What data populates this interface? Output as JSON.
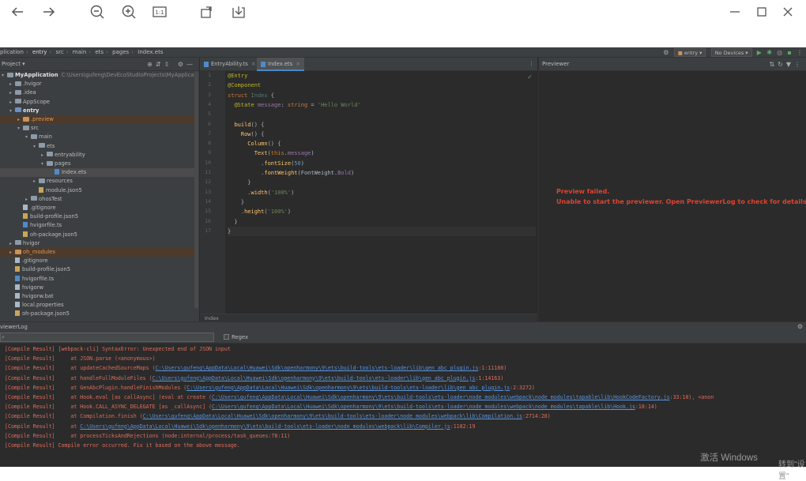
{
  "viewer": {
    "icons": [
      "back-arrow-icon",
      "forward-arrow-icon",
      "zoom-out-icon",
      "zoom-in-icon",
      "actual-size-icon",
      "rotate-icon",
      "save-icon",
      "minimize-icon",
      "maximize-icon",
      "close-icon"
    ],
    "actual_size_label": "1:1"
  },
  "navbar": {
    "crumbs": [
      "plication",
      "entry",
      "src",
      "main",
      "ets",
      "pages",
      "Index.ets"
    ],
    "module_combo": "entry",
    "device_combo": "No Devices"
  },
  "project": {
    "title": "Project",
    "rows": [
      {
        "label": "MyApplication",
        "path": "C:\\Users\\gufeng\\DevEcoStudioProjects\\MyApplication",
        "indent": 0,
        "type": "folder",
        "arrow": "▾",
        "bold": true
      },
      {
        "label": ".hvigor",
        "indent": 1,
        "type": "folder",
        "arrow": "▸"
      },
      {
        "label": ".idea",
        "indent": 1,
        "type": "folder",
        "arrow": "▸"
      },
      {
        "label": "AppScope",
        "indent": 1,
        "type": "folder",
        "arrow": "▸"
      },
      {
        "label": "entry",
        "indent": 1,
        "type": "folder-blue",
        "arrow": "▾",
        "bold": true
      },
      {
        "label": ".preview",
        "indent": 2,
        "type": "folder-orange",
        "arrow": "▸",
        "hl": true,
        "orange": true
      },
      {
        "label": "src",
        "indent": 2,
        "type": "folder",
        "arrow": "▾"
      },
      {
        "label": "main",
        "indent": 3,
        "type": "folder",
        "arrow": "▾"
      },
      {
        "label": "ets",
        "indent": 4,
        "type": "folder",
        "arrow": "▾"
      },
      {
        "label": "entryability",
        "indent": 5,
        "type": "folder",
        "arrow": "▸"
      },
      {
        "label": "pages",
        "indent": 5,
        "type": "folder",
        "arrow": "▾"
      },
      {
        "label": "Index.ets",
        "indent": 6,
        "type": "file-ts",
        "arrow": "",
        "sel": true
      },
      {
        "label": "resources",
        "indent": 4,
        "type": "folder",
        "arrow": "▸"
      },
      {
        "label": "module.json5",
        "indent": 4,
        "type": "file-json",
        "arrow": ""
      },
      {
        "label": "ohosTest",
        "indent": 3,
        "type": "folder",
        "arrow": "▸"
      },
      {
        "label": ".gitignore",
        "indent": 2,
        "type": "file",
        "arrow": ""
      },
      {
        "label": "build-profile.json5",
        "indent": 2,
        "type": "file-json",
        "arrow": ""
      },
      {
        "label": "hvigorfile.ts",
        "indent": 2,
        "type": "file-ts",
        "arrow": ""
      },
      {
        "label": "oh-package.json5",
        "indent": 2,
        "type": "file-json",
        "arrow": ""
      },
      {
        "label": "hvigor",
        "indent": 1,
        "type": "folder",
        "arrow": "▸"
      },
      {
        "label": "oh_modules",
        "indent": 1,
        "type": "folder-orange",
        "arrow": "▸",
        "hl": true,
        "orange": true
      },
      {
        "label": ".gitignore",
        "indent": 1,
        "type": "file",
        "arrow": ""
      },
      {
        "label": "build-profile.json5",
        "indent": 1,
        "type": "file-json",
        "arrow": ""
      },
      {
        "label": "hvigorfile.ts",
        "indent": 1,
        "type": "file-ts",
        "arrow": ""
      },
      {
        "label": "hvigorw",
        "indent": 1,
        "type": "file",
        "arrow": ""
      },
      {
        "label": "hvigorw.bat",
        "indent": 1,
        "type": "file",
        "arrow": ""
      },
      {
        "label": "local.properties",
        "indent": 1,
        "type": "file",
        "arrow": ""
      },
      {
        "label": "oh-package.json5",
        "indent": 1,
        "type": "file-json",
        "arrow": ""
      }
    ]
  },
  "editor": {
    "tabs": [
      {
        "label": "EntryAbility.ts",
        "active": false
      },
      {
        "label": "Index.ets",
        "active": true
      }
    ],
    "status": "Index",
    "line_numbers": [
      "1",
      "2",
      "3",
      "4",
      "5",
      "6",
      "7",
      "8",
      "9",
      "10",
      "11",
      "12",
      "13",
      "14",
      "15",
      "16",
      "17"
    ]
  },
  "previewer": {
    "title": "Previewer",
    "error_line1": "Preview failed.",
    "error_line2": "Unable to start the previewer. Open PreviewerLog to check for details."
  },
  "log": {
    "title": "viewerLog",
    "regex_label": "Regex",
    "lines": [
      {
        "text": "[Compile Result] [webpack-cli] SyntaxError: Unexpected end of JSON input"
      },
      {
        "text": "[Compile Result]     at JSON.parse (<anonymous>)"
      },
      {
        "text": "[Compile Result]     at updateCachedSourceMaps (",
        "link": "C:\\Users\\gufeng\\AppData\\Local\\Huawei\\Sdk\\openharmony\\9\\ets\\build-tools\\ets-loader\\lib\\gen_abc_plugin.js",
        "tail": ":1:11188)"
      },
      {
        "text": "[Compile Result]     at handleFullModuleFiles (",
        "link": "C:\\Users\\gufeng\\AppData\\Local\\Huawei\\Sdk\\openharmony\\9\\ets\\build-tools\\ets-loader\\lib\\gen_abc_plugin.js",
        "tail": ":1:14163)"
      },
      {
        "text": "[Compile Result]     at GenAbcPlugin.handleFinishModules (",
        "link": "C:\\Users\\gufeng\\AppData\\Local\\Huawei\\Sdk\\openharmony\\9\\ets\\build-tools\\ets-loader\\lib\\gen_abc_plugin.js",
        "tail": ":2:3272)"
      },
      {
        "text": "[Compile Result]     at Hook.eval [as callAsync] (eval at create (",
        "link": "C:\\Users\\gufeng\\AppData\\Local\\Huawei\\Sdk\\openharmony\\9\\ets\\build-tools\\ets-loader\\node_modules\\webpack\\node_modules\\tapable\\lib\\HookCodeFactory.js",
        "tail": ":33:10), <anon"
      },
      {
        "text": "[Compile Result]     at Hook.CALL_ASYNC_DELEGATE [as _callAsync] (",
        "link": "C:\\Users\\gufeng\\AppData\\Local\\Huawei\\Sdk\\openharmony\\9\\ets\\build-tools\\ets-loader\\node_modules\\webpack\\node_modules\\tapable\\lib\\Hook.js",
        "tail": ":18:14)"
      },
      {
        "text": "[Compile Result]     at Compilation.finish (",
        "link": "C:\\Users\\gufeng\\AppData\\Local\\Huawei\\Sdk\\openharmony\\9\\ets\\build-tools\\ets-loader\\node_modules\\webpack\\lib\\Compilation.js",
        "tail": ":2714:28)"
      },
      {
        "text": "[Compile Result]     at ",
        "link": "C:\\Users\\gufeng\\AppData\\Local\\Huawei\\Sdk\\openharmony\\9\\ets\\build-tools\\ets-loader\\node_modules\\webpack\\lib\\Compiler.js",
        "tail": ":1182:19"
      },
      {
        "text": "[Compile Result]     at processTicksAndRejections (node:internal/process/task_queues:78:11)"
      },
      {
        "text": "[Compile Result] Compile error occurred. Fix it based on the above message."
      }
    ]
  },
  "watermark": {
    "line1": "激活 Windows",
    "line2": "转到\"设置\""
  }
}
